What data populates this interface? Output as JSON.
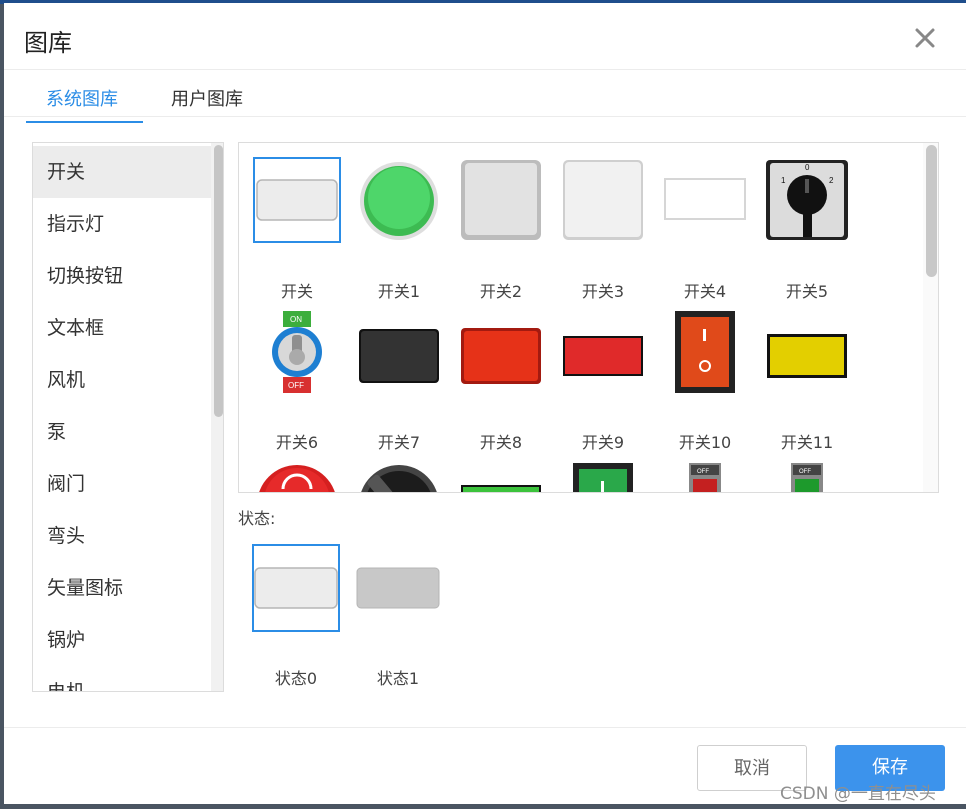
{
  "dialog": {
    "title": "图库"
  },
  "tabs": [
    {
      "label": "系统图库"
    },
    {
      "label": "用户图库"
    }
  ],
  "categories": [
    "开关",
    "指示灯",
    "切换按钮",
    "文本框",
    "风机",
    "泵",
    "阀门",
    "弯头",
    "矢量图标",
    "锅炉",
    "电机"
  ],
  "images": {
    "row1": [
      "开关",
      "开关1",
      "开关2",
      "开关3",
      "开关4",
      "开关5"
    ],
    "row2": [
      "开关6",
      "开关7",
      "开关8",
      "开关9",
      "开关10",
      "开关11"
    ]
  },
  "states": {
    "label": "状态:",
    "items": [
      "状态0",
      "状态1"
    ]
  },
  "buttons": {
    "cancel": "取消",
    "save": "保存"
  },
  "watermark": "CSDN @一直在尽头",
  "colors": {
    "accent": "#2b8de6",
    "save_button": "#3c93ec"
  }
}
